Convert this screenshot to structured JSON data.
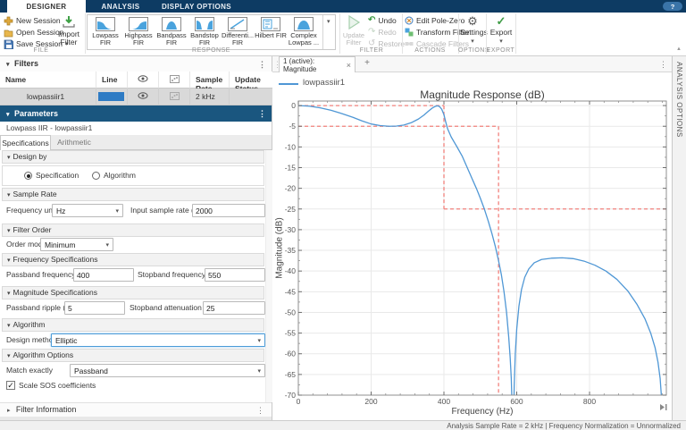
{
  "ribbon": {
    "tabs": [
      {
        "label": "DESIGNER"
      },
      {
        "label": "ANALYSIS"
      },
      {
        "label": "DISPLAY OPTIONS"
      }
    ],
    "help_label": "?",
    "groups": {
      "file": {
        "label": "FILE",
        "new_session": "New Session",
        "open_session": "Open Session",
        "save_session": "Save Session",
        "import_l1": "Import",
        "import_l2": "Filter"
      },
      "response": {
        "label": "RESPONSE",
        "items": [
          {
            "l1": "Lowpass",
            "l2": "FIR"
          },
          {
            "l1": "Highpass",
            "l2": "FIR"
          },
          {
            "l1": "Bandpass",
            "l2": "FIR"
          },
          {
            "l1": "Bandstop",
            "l2": "FIR"
          },
          {
            "l1": "Differenti...",
            "l2": "FIR"
          },
          {
            "l1": "Hilbert FIR",
            "l2": ""
          },
          {
            "l1": "Complex",
            "l2": "Lowpas ..."
          }
        ]
      },
      "filter": {
        "label": "FILTER",
        "update_l1": "Update",
        "update_l2": "Filter",
        "undo": "Undo",
        "redo": "Redo",
        "restore": "Restore"
      },
      "actions": {
        "label": "ACTIONS",
        "edit_pole_zero": "Edit Pole-Zero",
        "transform_filter": "Transform Filter",
        "cascade_filters": "Cascade Filters"
      },
      "options": {
        "label": "OPTIONS",
        "settings": "Settings"
      },
      "export": {
        "label": "EXPORT",
        "export": "Export"
      }
    }
  },
  "filters_panel": {
    "title": "Filters",
    "columns": {
      "name": "Name",
      "line": "Line",
      "sample_rate": "Sample Rate",
      "update_status": "Update Status"
    },
    "row": {
      "name": "lowpassiir1",
      "line_color": "#2e7bc4",
      "sample_rate": "2 kHz",
      "update_status": ""
    }
  },
  "parameters": {
    "title": "Parameters",
    "subtitle": "Lowpass IIR - lowpassiir1",
    "tabs": [
      {
        "label": "Specifications"
      },
      {
        "label": "Arithmetic"
      }
    ],
    "design_by": {
      "header": "Design by",
      "options": [
        {
          "label": "Specification"
        },
        {
          "label": "Algorithm"
        }
      ],
      "selected": "Specification"
    },
    "sample_rate": {
      "header": "Sample Rate",
      "freq_units_label": "Frequency units",
      "freq_units_value": "Hz",
      "input_rate_label": "Input sample rate (Hz)",
      "input_rate_value": "2000"
    },
    "filter_order": {
      "header": "Filter Order",
      "order_mode_label": "Order mode",
      "order_mode_value": "Minimum"
    },
    "frequency_specs": {
      "header": "Frequency Specifications",
      "passband_label": "Passband frequency (Hz)",
      "passband_value": "400",
      "stopband_label": "Stopband frequency (Hz)",
      "stopband_value": "550"
    },
    "magnitude_specs": {
      "header": "Magnitude Specifications",
      "ripple_label": "Passband ripple (dB)",
      "ripple_value": "5",
      "atten_label": "Stopband attenuation (dB)",
      "atten_value": "25"
    },
    "algorithm": {
      "header": "Algorithm",
      "design_method_label": "Design method",
      "design_method_value": "Elliptic"
    },
    "algorithm_options": {
      "header": "Algorithm Options",
      "match_label": "Match exactly",
      "match_value": "Passband",
      "scale_sos_label": "Scale SOS coefficients",
      "scale_sos_checked": true
    },
    "filter_information": {
      "header": "Filter Information"
    }
  },
  "plot": {
    "tab_label": "1 (active): Magnitude",
    "legend": {
      "label": "lowpassiir1",
      "color": "#4f97d5"
    }
  },
  "analysis_options_label": "ANALYSIS OPTIONS",
  "status_bar": "Analysis Sample Rate = 2 kHz | Frequency Normalization = Unnormalized",
  "chart_data": {
    "type": "line",
    "title": "Magnitude Response (dB)",
    "xlabel": "Frequency (Hz)",
    "ylabel": "Magnitude (dB)",
    "xlim": [
      0,
      1011
    ],
    "ylim": [
      -70,
      1.1
    ],
    "xticks": [
      0,
      200,
      400,
      600,
      800
    ],
    "yticks": [
      0,
      -5,
      -10,
      -15,
      -20,
      -25,
      -30,
      -35,
      -40,
      -45,
      -50,
      -55,
      -60,
      -65,
      -70
    ],
    "x_minor_step": 40,
    "y_minor_step": 2.5,
    "grid": true,
    "legend_position": "top-left-above-axes",
    "series": [
      {
        "name": "lowpassiir1",
        "color": "#4f97d5",
        "points": [
          [
            0,
            0
          ],
          [
            30,
            -0.15
          ],
          [
            60,
            -0.55
          ],
          [
            90,
            -1.15
          ],
          [
            120,
            -1.95
          ],
          [
            150,
            -2.85
          ],
          [
            175,
            -3.7
          ],
          [
            200,
            -4.45
          ],
          [
            225,
            -4.85
          ],
          [
            250,
            -5.0
          ],
          [
            270,
            -4.95
          ],
          [
            290,
            -4.7
          ],
          [
            310,
            -4.15
          ],
          [
            330,
            -3.25
          ],
          [
            345,
            -2.3
          ],
          [
            358,
            -1.3
          ],
          [
            368,
            -0.6
          ],
          [
            376,
            -0.2
          ],
          [
            382,
            -0.05
          ],
          [
            388,
            -0.25
          ],
          [
            394,
            -0.9
          ],
          [
            400,
            -2.2
          ],
          [
            405,
            -4.0
          ],
          [
            410,
            -5.6
          ],
          [
            420,
            -7.6
          ],
          [
            436,
            -10
          ],
          [
            450,
            -12.2
          ],
          [
            464,
            -15
          ],
          [
            478,
            -17.8
          ],
          [
            490,
            -20.2
          ],
          [
            500,
            -22.4
          ],
          [
            511,
            -25
          ],
          [
            522,
            -28
          ],
          [
            532,
            -31
          ],
          [
            541,
            -34
          ],
          [
            550,
            -37.5
          ],
          [
            558,
            -41
          ],
          [
            565,
            -45
          ],
          [
            572,
            -50
          ],
          [
            578,
            -56
          ],
          [
            582,
            -61
          ],
          [
            585,
            -66
          ],
          [
            587,
            -72
          ],
          [
            588,
            -78
          ],
          [
            591,
            -78
          ],
          [
            593,
            -68
          ],
          [
            596,
            -60
          ],
          [
            600,
            -54
          ],
          [
            606,
            -48.5
          ],
          [
            613,
            -44.5
          ],
          [
            622,
            -41.5
          ],
          [
            633,
            -39.5
          ],
          [
            648,
            -38
          ],
          [
            668,
            -37.2
          ],
          [
            695,
            -36.9
          ],
          [
            725,
            -36.8
          ],
          [
            755,
            -37
          ],
          [
            785,
            -37.6
          ],
          [
            815,
            -38.6
          ],
          [
            845,
            -40
          ],
          [
            875,
            -42
          ],
          [
            905,
            -44.8
          ],
          [
            930,
            -48
          ],
          [
            952,
            -51.5
          ],
          [
            968,
            -55
          ],
          [
            980,
            -58.5
          ],
          [
            988,
            -62
          ],
          [
            994,
            -66
          ],
          [
            998,
            -71
          ],
          [
            1000,
            -78
          ]
        ]
      }
    ],
    "spec_mask": {
      "color": "#f2817c",
      "dash": "4 3",
      "segments": [
        [
          [
            0,
            0
          ],
          [
            400,
            0
          ]
        ],
        [
          [
            400,
            0
          ],
          [
            400,
            -25
          ]
        ],
        [
          [
            400,
            -25
          ],
          [
            1011,
            -25
          ]
        ],
        [
          [
            0,
            -5
          ],
          [
            550,
            -5
          ]
        ],
        [
          [
            550,
            -5
          ],
          [
            550,
            -72
          ]
        ]
      ]
    }
  }
}
